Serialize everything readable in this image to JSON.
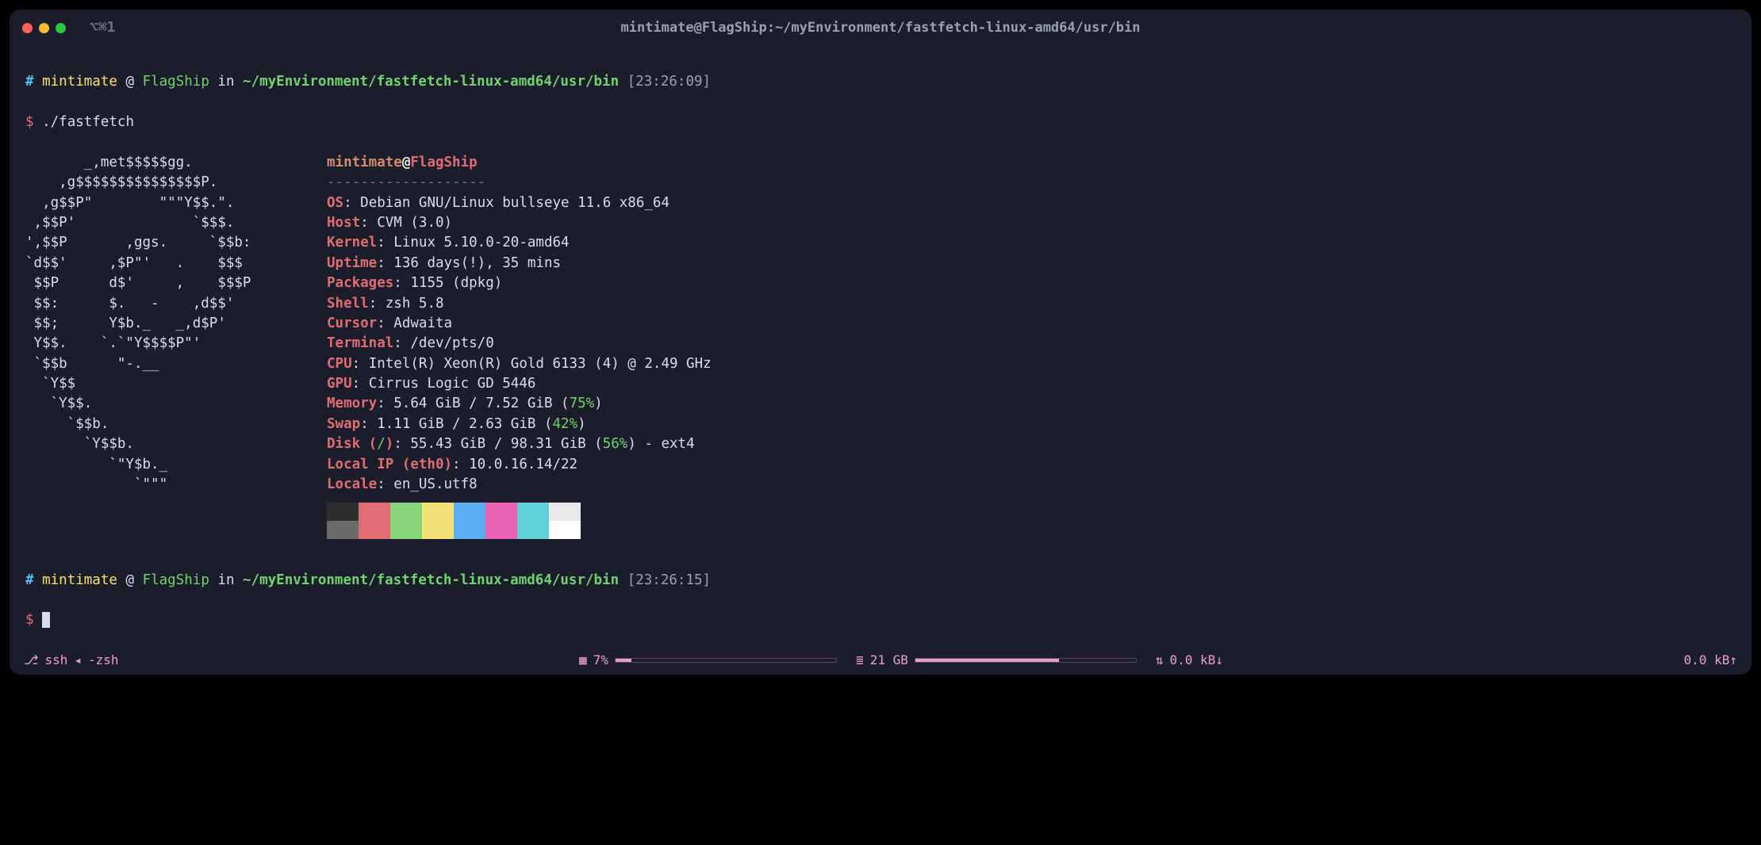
{
  "window": {
    "tab_indicator": "⌥⌘1",
    "title": "mintimate@FlagShip:~/myEnvironment/fastfetch-linux-amd64/usr/bin"
  },
  "prompt1": {
    "hash": "#",
    "user": "mintimate",
    "at": "@",
    "host": "FlagShip",
    "in": "in",
    "path": "~/myEnvironment/fastfetch-linux-amd64/usr/bin",
    "time": "[23:26:09]",
    "dollar": "$",
    "command": "./fastfetch"
  },
  "prompt2": {
    "hash": "#",
    "user": "mintimate",
    "at": "@",
    "host": "FlagShip",
    "in": "in",
    "path": "~/myEnvironment/fastfetch-linux-amd64/usr/bin",
    "time": "[23:26:15]",
    "dollar": "$"
  },
  "logo_lines": [
    "       _,met$$$$$gg.",
    "    ,g$$$$$$$$$$$$$$$P.",
    "  ,g$$P\"        \"\"\"Y$$.\".",
    " ,$$P'              `$$$.",
    "',$$P       ,ggs.     `$$b:",
    "`d$$'     ,$P\"'   .    $$$",
    " $$P      d$'     ,    $$$P",
    " $$:      $.   -    ,d$$'",
    " $$;      Y$b._   _,d$P'",
    " Y$$.    `.`\"Y$$$$P\"'",
    " `$$b      \"-.__",
    "  `Y$$",
    "   `Y$$.",
    "     `$$b.",
    "       `Y$$b.",
    "          `\"Y$b._",
    "             `\"\"\""
  ],
  "logo_accent_lines": [
    5,
    6,
    7,
    8,
    9,
    10
  ],
  "header": {
    "user": "mintimate",
    "at": "@",
    "host": "FlagShip",
    "separator": "-------------------"
  },
  "info": [
    {
      "key": "OS",
      "value": "Debian GNU/Linux bullseye 11.6 x86_64"
    },
    {
      "key": "Host",
      "value": "CVM (3.0)"
    },
    {
      "key": "Kernel",
      "value": "Linux 5.10.0-20-amd64"
    },
    {
      "key": "Uptime",
      "value": "136 days(!), 35 mins"
    },
    {
      "key": "Packages",
      "value": "1155 (dpkg)"
    },
    {
      "key": "Shell",
      "value": "zsh 5.8"
    },
    {
      "key": "Cursor",
      "value": "Adwaita"
    },
    {
      "key": "Terminal",
      "value": "/dev/pts/0"
    },
    {
      "key": "CPU",
      "value": "Intel(R) Xeon(R) Gold 6133 (4) @ 2.49 GHz"
    },
    {
      "key": "GPU",
      "value": "Cirrus Logic GD 5446"
    },
    {
      "key": "Memory",
      "value": "5.64 GiB / 7.52 GiB (",
      "pct": "75%",
      "tail": ")"
    },
    {
      "key": "Swap",
      "value": "1.11 GiB / 2.63 GiB (",
      "pct": "42%",
      "tail": ")"
    },
    {
      "key": "Disk (",
      "key_path": "/",
      "key_tail": ")",
      "value": "55.43 GiB / 98.31 GiB (",
      "pct": "56%",
      "tail": ") - ext4"
    },
    {
      "key": "Local IP (eth0)",
      "value": "10.0.16.14/22"
    },
    {
      "key": "Locale",
      "value": "en_US.utf8"
    }
  ],
  "swatches_top": [
    "#2e2e2e",
    "#e06c75",
    "#88d679",
    "#f2e178",
    "#5aaef0",
    "#e863b5",
    "#5fd0d8",
    "#e8e8e8"
  ],
  "swatches_bottom": [
    "#6b6b6b",
    "#e06c75",
    "#88d679",
    "#f2e178",
    "#5aaef0",
    "#e863b5",
    "#5fd0d8",
    "#ffffff"
  ],
  "statusbar": {
    "left1": "ssh",
    "left_sep": "◂",
    "left2": "-zsh",
    "cpu_label": "7%",
    "ram_label": "21 GB",
    "net_down": "0.0 kB↓",
    "net_up": "0.0 kB↑",
    "cpu_pct": 7,
    "ram_pct": 65
  }
}
